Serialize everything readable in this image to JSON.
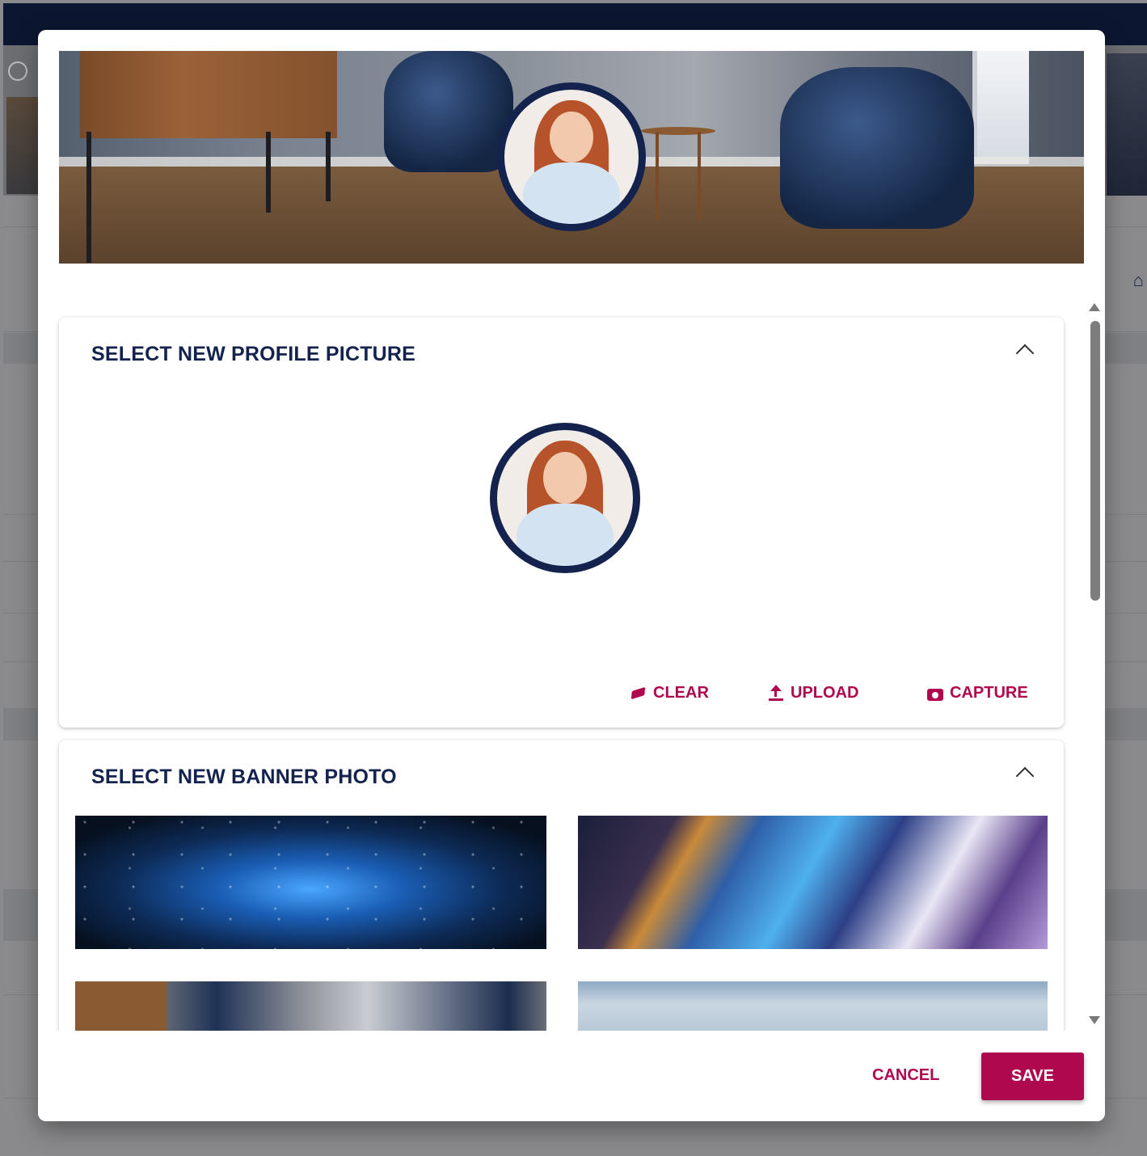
{
  "background": {
    "home_icon": "home-icon"
  },
  "profile_section": {
    "title": "SELECT NEW PROFILE PICTURE",
    "clear_label": "CLEAR",
    "upload_label": "UPLOAD",
    "capture_label": "CAPTURE"
  },
  "banner_section": {
    "title": "SELECT NEW BANNER PHOTO",
    "options": [
      "galaxy",
      "light-streaks",
      "living-room",
      "sky"
    ]
  },
  "footer": {
    "cancel_label": "CANCEL",
    "save_label": "SAVE"
  },
  "colors": {
    "accent": "#b0084e",
    "navy": "#14234d",
    "topbar": "#0c1630"
  },
  "icons": {
    "clear": "eraser-icon",
    "upload": "upload-icon",
    "capture": "camera-icon",
    "collapse": "chevron-up-icon"
  }
}
